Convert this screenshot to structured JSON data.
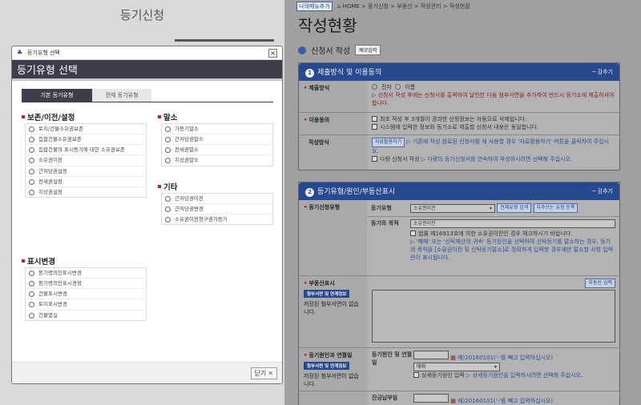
{
  "background": {
    "left_title": "등기신청",
    "breadcrumb": {
      "badge": "나의메뉴추가",
      "path": "HOME > 등기신청 > 부동산 > 작성관리 > 작성현황"
    },
    "page_title": "작성현황",
    "section_title": "신청서 작성",
    "memo_button": "메모입력",
    "panel1": {
      "number": "1",
      "title": "제출방식 및 이용동의",
      "fold": "─ 감추기",
      "rows": [
        {
          "label": "제출방식",
          "radio_a": "전자",
          "radio_b": "이름",
          "note": "신청서 작성 후에는 신청서를 출력하여 날인한 다음 첨부서면을 추가하여 반드시 등기소에 제출하셔야 합니다."
        },
        {
          "label": "이용동의",
          "line1": "최초 작성 후 3개월이 경과한 신청정보는 자동으로 삭제됩니다.",
          "line2": "시스템에 입력한 정보와 등기소로 제출할 신청서 내용은 동일합니다."
        },
        {
          "label": "작성방식",
          "button": "자료활용하기",
          "text1": "기존에 작성 완료된 신청서를 재 사용할 경우 '자료활용하기' 버튼을 클릭하여 주십시오.",
          "text2": "다량 신청서 작성",
          "text3": "다량의 등기신청서를 연속하여 작성하시려면 선택해 주십시오."
        }
      ]
    },
    "panel2": {
      "number": "2",
      "title": "등기유형/원인/부동산표시",
      "fold": "─ 감추기",
      "type_label": "등기신청유형",
      "type_sub": "등기유형",
      "type_value": "소유권이전",
      "type_btn1": "전체유형 검색",
      "type_btn2": "자주쓰는 유형 등록",
      "purpose_label": "등기의 목적",
      "purpose_value": "소유권이전",
      "law_check": "법률 제16913호에 의한 소유권이전인 경우 체크하시기 바랍니다.",
      "law_note": "'매매' 또는 '신탁재산의 귀속' 등기원인을 선택하여 신탁등기를 말소하는 경우, 등기의 목적을 [소유권이전 및 신탁등기말소]로 정확하게 입력한 경우에만 말소할 사항 입력 란이 표시됩니다.",
      "property_label": "부동산표시",
      "property_btn": "첨부서면 및 연계정보",
      "property_note": "저장된 첨부서면이 없습니다.",
      "property_input_btn": "부동산 입력",
      "cause_label": "등기원인과 연월일",
      "cause_btn": "첨부서면 및 연계정보",
      "cause_note": "저장된 첨부서면이 없습니다.",
      "cause_sub": "등기원인 및 연월일",
      "cause_hint": "예)20160101('-'를 빼고 입력하십시오)",
      "cause_select": "매매",
      "cause_detail_check": "상세등기원인 입력",
      "cause_detail_note": "상세등기원인을 입력하시려면 선택해 주십시오.",
      "balance_sub": "잔금납부일",
      "balance_hint": "예)20160101('-'를 빼고 입력하십시오)"
    }
  },
  "modal": {
    "window_title": "등기유형 선택",
    "header": "등기유형 선택",
    "tabs": [
      {
        "label": "기본 등기유형",
        "active": true
      },
      {
        "label": "전체 등기유형",
        "active": false
      }
    ],
    "groups": {
      "preserve": {
        "title": "보존/이전/설정",
        "options": [
          "토지/건물소유권보존",
          "집합건물소유권보존",
          "집합건물의 표시등기에 대한 소유권보존",
          "소유권이전",
          "근저당권설정",
          "전세권설정",
          "지상권설정"
        ]
      },
      "change": {
        "title": "표시변경",
        "options": [
          "등기명의인표시변경",
          "등기명의인표시경정",
          "건물표시변경",
          "토지표시변경",
          "건물멸실"
        ]
      },
      "cancel": {
        "title": "말소",
        "options": [
          "가등기말소",
          "근저당권말소",
          "전세권말소",
          "지상권말소"
        ]
      },
      "etc": {
        "title": "기타",
        "options": [
          "근저당권이전",
          "근저당권변경",
          "소유권이전청구권가등기"
        ]
      }
    },
    "close_button": "닫기"
  }
}
